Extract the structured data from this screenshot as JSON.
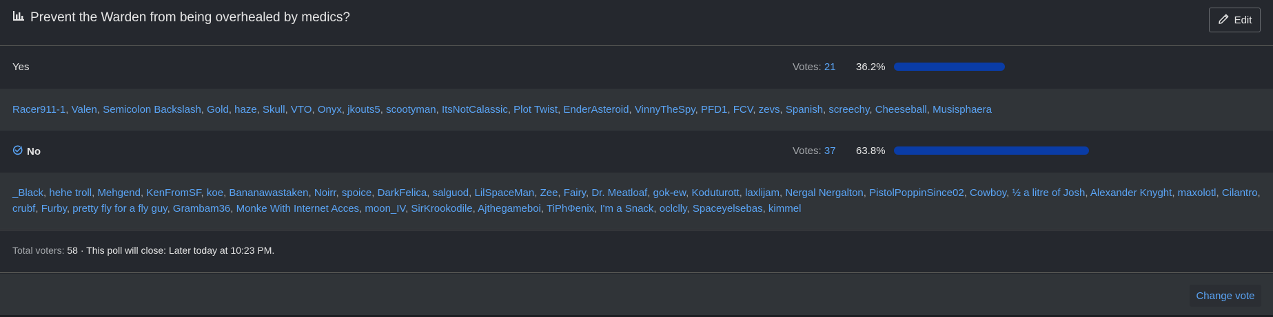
{
  "poll": {
    "title": "Prevent the Warden from being overhealed by medics?",
    "edit_label": "Edit",
    "icon": "bar-chart-icon"
  },
  "options": [
    {
      "label": "Yes",
      "votes_label": "Votes:",
      "votes": "21",
      "percent_text": "36.2%",
      "percent": 36.2,
      "selected": false,
      "voters": [
        "Racer911-1",
        "Valen",
        "Semicolon Backslash",
        "Gold",
        "haze",
        "Skull",
        "VTO",
        "Onyx",
        "jkouts5",
        "scootyman",
        "ItsNotCalassic",
        "Plot Twist",
        "EnderAsteroid",
        "VinnyTheSpy",
        "PFD1",
        "FCV",
        "zevs",
        "Spanish",
        "screechy",
        "Cheeseball",
        "Musisphaera"
      ]
    },
    {
      "label": "No",
      "votes_label": "Votes:",
      "votes": "37",
      "percent_text": "63.8%",
      "percent": 63.8,
      "selected": true,
      "voters": [
        "_Black",
        "hehe troll",
        "Mehgend",
        "KenFromSF",
        "koe",
        "Bananawastaken",
        "Noirr",
        "spoice",
        "DarkFelica",
        "salguod",
        "LilSpaceMan",
        "Zee",
        "Fairy",
        "Dr. Meatloaf",
        "gok-ew",
        "Koduturott",
        "laxlijam",
        "Nergal Nergalton",
        "PistolPoppinSince02",
        "Cowboy",
        "½ a litre of Josh",
        "Alexander Knyght",
        "maxolotl",
        "Cilantro",
        "crubf",
        "Furby",
        "pretty fly for a fly guy",
        "Grambam36",
        "Monke With Internet Acces",
        "moon_IV",
        "SirKrookodile",
        "Ajthegameboi",
        "TiPhФenix",
        "I'm a Snack",
        "oclclly",
        "Spaceyelsebas",
        "kimmel"
      ]
    }
  ],
  "footer": {
    "total_label": "Total voters:",
    "total": "58",
    "close_text": "· This poll will close: Later today at 10:23 PM.",
    "change_vote_label": "Change vote"
  },
  "colors": {
    "accent": "#5aa4f5",
    "bar": "#0a3ca6",
    "background": "#25282e",
    "row_alt": "#303438"
  },
  "bar_track_max_percent": 100
}
